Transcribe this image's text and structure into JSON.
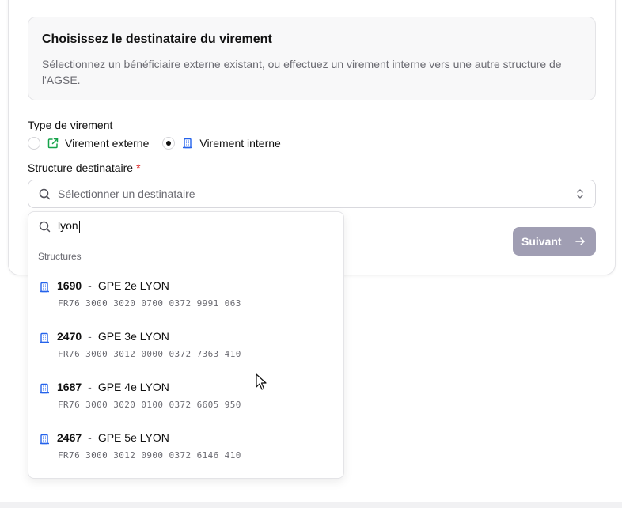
{
  "info": {
    "title": "Choisissez le destinataire du virement",
    "description": "Sélectionnez un bénéficiaire externe existant, ou effectuez un virement interne vers une autre structure de l'AGSE."
  },
  "transfer_type": {
    "label": "Type de virement",
    "options": [
      {
        "label": "Virement externe",
        "selected": false,
        "icon": "external-link-icon"
      },
      {
        "label": "Virement interne",
        "selected": true,
        "icon": "building-icon"
      }
    ]
  },
  "structure": {
    "label": "Structure destinataire",
    "required_mark": "*",
    "placeholder": "Sélectionner un destinataire"
  },
  "dropdown": {
    "search_value": "lyon",
    "group_label": "Structures",
    "items": [
      {
        "code": "1690",
        "name": "GPE 2e LYON",
        "iban": "FR76 3000 3020 0700 0372 9991 063"
      },
      {
        "code": "2470",
        "name": "GPE 3e LYON",
        "iban": "FR76 3000 3012 0000 0372 7363 410"
      },
      {
        "code": "1687",
        "name": "GPE 4e LYON",
        "iban": "FR76 3000 3020 0100 0372 6605 950"
      },
      {
        "code": "2467",
        "name": "GPE 5e LYON",
        "iban": "FR76 3000 3012 0900 0372 6146 410"
      }
    ],
    "separator": "-"
  },
  "next_button": {
    "label": "Suivant"
  },
  "colors": {
    "accent_disabled": "#a09eb3",
    "required": "#dc2626",
    "external_icon": "#16a34a",
    "building_icon": "#2563eb"
  }
}
